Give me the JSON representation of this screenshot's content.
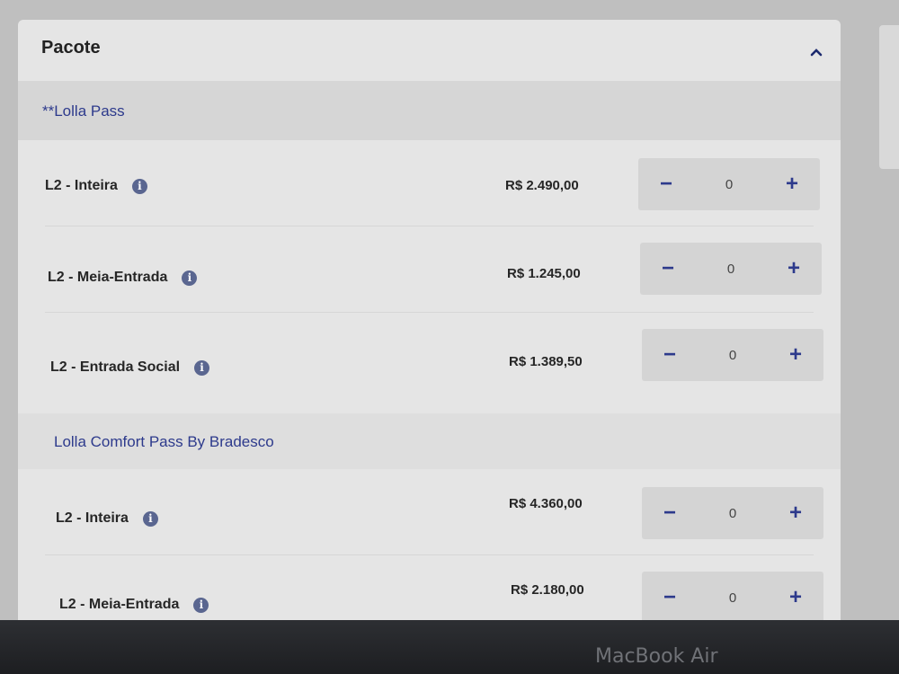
{
  "package": {
    "title": "Pacote",
    "sections": [
      {
        "name": "**Lolla Pass",
        "items": [
          {
            "label": "L2 - Inteira",
            "price": "R$ 2.490,00",
            "quantity": "0"
          },
          {
            "label": "L2 - Meia-Entrada",
            "price": "R$ 1.245,00",
            "quantity": "0"
          },
          {
            "label": "L2 - Entrada Social",
            "price": "R$ 1.389,50",
            "quantity": "0"
          }
        ]
      },
      {
        "name": "Lolla Comfort Pass By Bradesco",
        "items": [
          {
            "label": "L2 - Inteira",
            "price": "R$ 4.360,00",
            "quantity": "0"
          },
          {
            "label": "L2 - Meia-Entrada",
            "price": "R$ 2.180,00",
            "quantity": "0"
          }
        ]
      }
    ]
  },
  "icons": {
    "collapse": "chevron-up-icon",
    "info": "info-icon",
    "decrement": "minus-icon",
    "increment": "plus-icon"
  },
  "glyphs": {
    "info": "i",
    "minus": "−",
    "plus": "+"
  },
  "device": {
    "brand": "MacBook Air"
  },
  "colors": {
    "accent": "#2d3a8c",
    "info_icon": "#5a6690",
    "card_bg": "#e5e5e5"
  }
}
